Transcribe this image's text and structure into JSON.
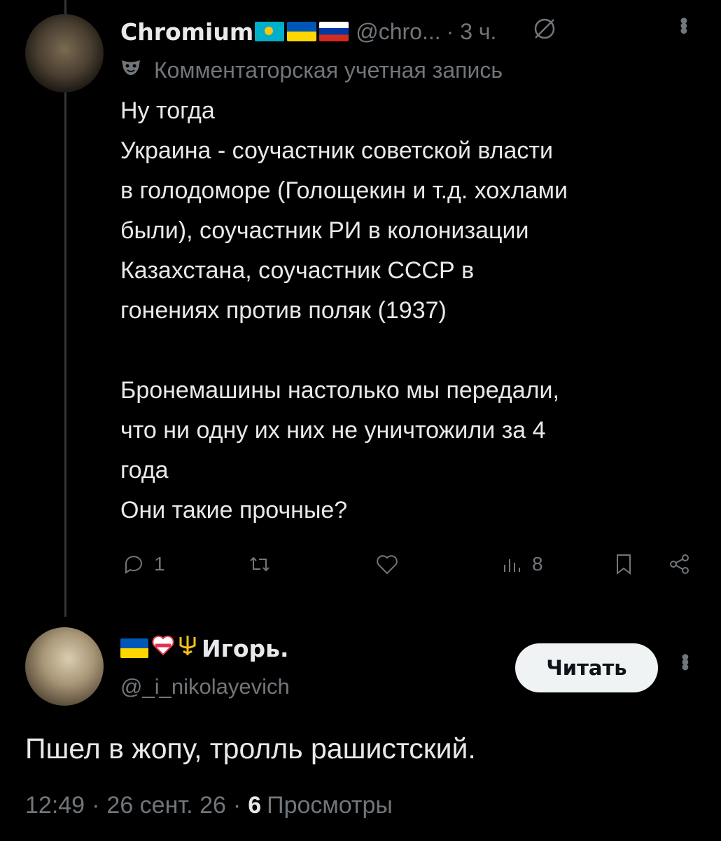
{
  "tweet": {
    "author_name": "Chromium",
    "author_flags": [
      "kz-flag",
      "ua-flag",
      "ru-flag"
    ],
    "handle": "@chro...",
    "time": "· 3 ч.",
    "subtitle": "Комментаторская учетная запись",
    "text_lines": [
      "Ну тогда",
      "Украина - соучастник советской власти",
      "в голодоморе (Голощекин и т.д. хохлами",
      "были), соучастник РИ в колонизации",
      "Казахстана, соучастник СССР в",
      "гонениях против поляк (1937)",
      "",
      "Бронемашины настолько мы передали,",
      "что ни одну их них не уничтожили за 4",
      "года",
      "Они такие прочные?"
    ],
    "actions": {
      "reply_count": "1",
      "retweet_count": "",
      "like_count": "",
      "views_count": "8"
    }
  },
  "reply": {
    "author_name": "Игорь.",
    "author_emojis": [
      "ua-flag",
      "heart-icon",
      "trident-icon"
    ],
    "handle": "@_i_nikolayevich",
    "follow_label": "Читать",
    "text": "Пшел в жопу, тролль рашистский.",
    "time": "12:49",
    "date": "26 сент. 26",
    "views_count": "6",
    "views_label": "Просмотры"
  },
  "colors": {
    "background": "#000000",
    "text": "#e7e9ea",
    "muted": "#71767b",
    "thread_line": "#333639",
    "button_bg": "#eff3f4"
  }
}
